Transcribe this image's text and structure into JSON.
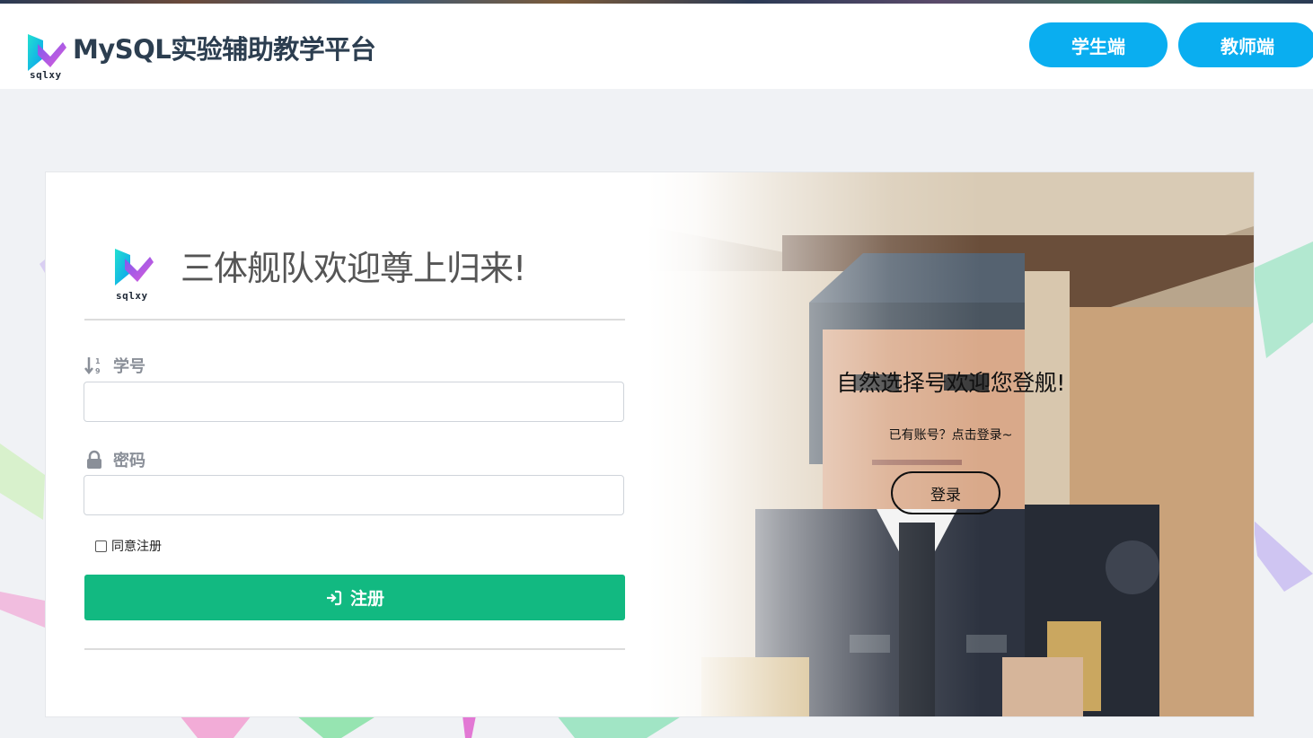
{
  "header": {
    "brand_mark_text": "sqlxy",
    "title": "MySQL实验辅助教学平台",
    "student_button": "学生端",
    "teacher_button": "教师端"
  },
  "register_form": {
    "brand_mark_text": "sqlxy",
    "welcome": "三体舰队欢迎尊上归来!",
    "student_id_label": "学号",
    "student_id_value": "",
    "password_label": "密码",
    "password_value": "",
    "agree_label": "同意注册",
    "agree_checked": false,
    "register_button": "注册"
  },
  "side_panel": {
    "title": "自然选择号欢迎您登舰!",
    "subtitle": "已有账号？点击登录~",
    "login_button": "登录"
  },
  "colors": {
    "accent_blue": "#0aaef0",
    "register_green": "#12b981",
    "background": "#f0f2f5"
  },
  "icons": {
    "brand": "sqlxy-logo-icon",
    "student_id": "sort-numeric-icon",
    "password": "lock-icon",
    "register": "sign-in-icon"
  }
}
